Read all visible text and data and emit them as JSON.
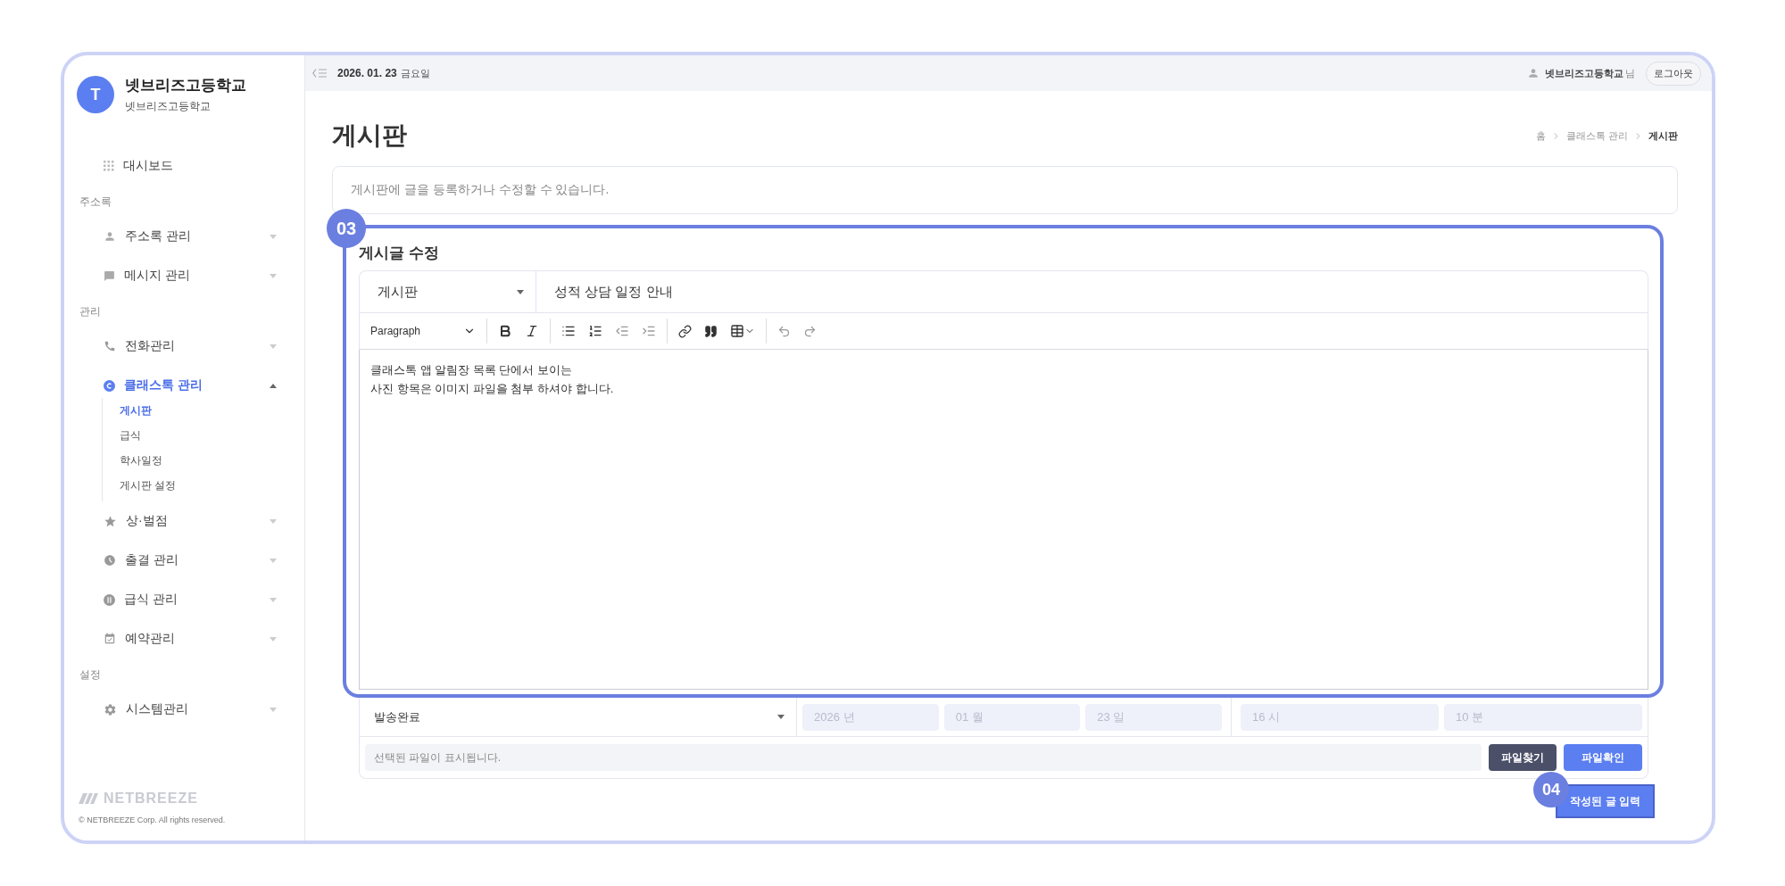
{
  "sidebar": {
    "avatar": "T",
    "school_name": "넷브리즈고등학교",
    "school_sub": "넷브리즈고등학교",
    "sections": [
      {
        "items": [
          {
            "kind": "link",
            "label": "대시보드",
            "selected": false
          }
        ]
      },
      {
        "heading": "주소록",
        "items": [
          {
            "kind": "group",
            "label": "주소록 관리",
            "selected": false,
            "expanded": false
          },
          {
            "kind": "group",
            "label": "메시지 관리",
            "selected": false,
            "expanded": false
          }
        ]
      },
      {
        "heading": "관리",
        "items": [
          {
            "kind": "group",
            "label": "전화관리",
            "selected": false,
            "expanded": false
          },
          {
            "kind": "group",
            "label": "클래스톡 관리",
            "selected": true,
            "expanded": true,
            "children": [
              {
                "label": "게시판",
                "selected": true
              },
              {
                "label": "급식",
                "selected": false
              },
              {
                "label": "학사일정",
                "selected": false
              },
              {
                "label": "게시판 설정",
                "selected": false
              }
            ]
          },
          {
            "kind": "group",
            "label": "상·벌점",
            "selected": false,
            "expanded": false
          },
          {
            "kind": "group",
            "label": "출결 관리",
            "selected": false,
            "expanded": false
          },
          {
            "kind": "group",
            "label": "급식 관리",
            "selected": false,
            "expanded": false
          },
          {
            "kind": "group",
            "label": "예약관리",
            "selected": false,
            "expanded": false
          }
        ]
      },
      {
        "heading": "설정",
        "items": [
          {
            "kind": "group",
            "label": "시스템관리",
            "selected": false,
            "expanded": false
          }
        ]
      }
    ],
    "footer": {
      "logo": "NETBREEZE",
      "copyright": "© NETBREEZE Corp. All rights reserved."
    }
  },
  "topbar": {
    "date": "2026. 01. 23",
    "weekday": "금요일",
    "user": "넷브리즈고등학교",
    "honorific": "님",
    "logout": "로그아웃"
  },
  "page": {
    "title": "게시판",
    "breadcrumb": [
      {
        "label": "홈",
        "selected": false
      },
      {
        "label": "클래스톡 관리",
        "selected": false
      },
      {
        "label": "게시판",
        "selected": true
      }
    ],
    "description": "게시판에 글을 등록하거나 수정할 수 있습니다."
  },
  "editor": {
    "annotation": "03",
    "title": "게시글 수정",
    "board": "게시판",
    "post_title": "성적 상담 일정 안내",
    "format": "Paragraph",
    "body": [
      "클래스톡 앱 알림장 목록 단에서 보이는",
      "사진 항목은 이미지 파일을 첨부 하셔야 합니다."
    ]
  },
  "schedule": {
    "status": "발송완료",
    "fields": [
      {
        "value": "2026 년",
        "disabled": true
      },
      {
        "value": "01 월",
        "disabled": true
      },
      {
        "value": "23 일",
        "disabled": true
      },
      {
        "value": "16 시",
        "disabled": true
      },
      {
        "value": "10 분",
        "disabled": true
      }
    ]
  },
  "file": {
    "placeholder": "선택된 파일이 표시됩니다.",
    "buttons": [
      {
        "kind": "dark",
        "label": "파일찾기"
      },
      {
        "kind": "primary",
        "label": "파일확인"
      }
    ]
  },
  "submit": {
    "annotation": "04",
    "label": "작성된 글 입력"
  }
}
